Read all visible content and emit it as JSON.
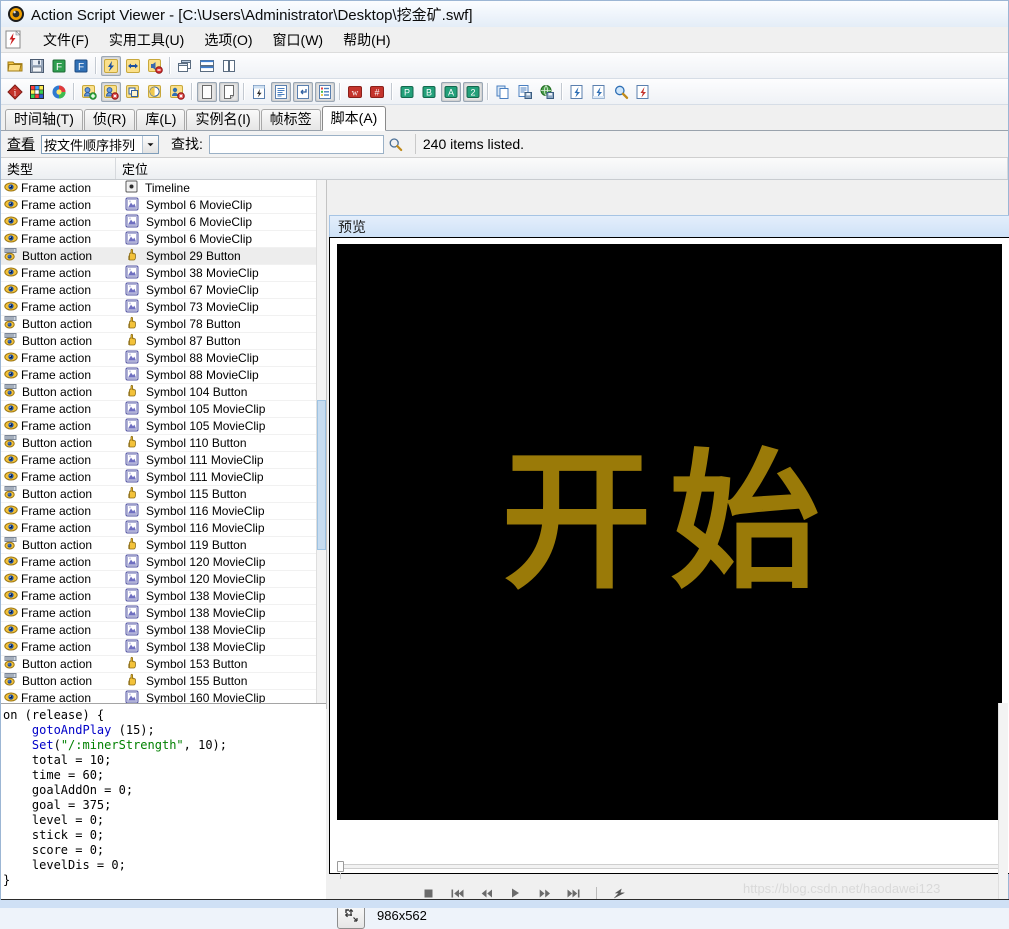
{
  "window": {
    "title": "Action Script Viewer - [C:\\Users\\Administrator\\Desktop\\挖金矿.swf]",
    "icon": "asv-app-icon"
  },
  "menubar": {
    "items": [
      {
        "label": "文件(F)",
        "name": "menu-file"
      },
      {
        "label": "实用工具(U)",
        "name": "menu-tools"
      },
      {
        "label": "选项(O)",
        "name": "menu-options"
      },
      {
        "label": "窗口(W)",
        "name": "menu-window"
      },
      {
        "label": "帮助(H)",
        "name": "menu-help"
      }
    ]
  },
  "toolbar_row1": [
    {
      "name": "open-icon",
      "kind": "sep",
      "sep": false
    },
    {
      "name": "open-folder-icon"
    },
    {
      "name": "save-icon"
    },
    {
      "name": "export-f-green-icon"
    },
    {
      "name": "export-f-blue-icon"
    },
    {
      "name": "flash-action-icon"
    },
    {
      "name": "resize-arrows-icon"
    },
    {
      "name": "remove-sound-icon"
    },
    {
      "name": "cascade-windows-icon"
    },
    {
      "name": "tile-horizontal-icon"
    },
    {
      "name": "tile-vertical-icon"
    }
  ],
  "toolbar_row2": [
    {
      "name": "info-diamond-icon"
    },
    {
      "name": "color-palette-icon"
    },
    {
      "name": "color-wheel-icon"
    },
    {
      "name": "add-symbol-icon"
    },
    {
      "name": "edit-symbol-icon"
    },
    {
      "name": "duplicate-symbol-icon"
    },
    {
      "name": "circle-gradient-icon"
    },
    {
      "name": "delete-symbol-icon"
    },
    {
      "name": "page-white-icon"
    },
    {
      "name": "page-note-icon"
    },
    {
      "name": "script-flash-icon"
    },
    {
      "name": "text-lines-icon"
    },
    {
      "name": "return-arrow-icon"
    },
    {
      "name": "list-detail-icon"
    },
    {
      "name": "w-red-icon"
    },
    {
      "name": "hash-red-icon"
    },
    {
      "name": "p-green-icon"
    },
    {
      "name": "b-green-icon"
    },
    {
      "name": "a-green-icon"
    },
    {
      "name": "two-green-icon"
    },
    {
      "name": "copy-icon"
    },
    {
      "name": "save-page-icon"
    },
    {
      "name": "save-web-icon"
    },
    {
      "name": "flash-export-icon"
    },
    {
      "name": "flash-export2-icon"
    },
    {
      "name": "zoom-search-icon"
    },
    {
      "name": "flash-red-icon"
    }
  ],
  "tabs": [
    {
      "label": "时间轴(T)",
      "name": "tab-timeline",
      "active": false
    },
    {
      "label": "侦(R)",
      "name": "tab-frames",
      "active": false
    },
    {
      "label": "库(L)",
      "name": "tab-library",
      "active": false
    },
    {
      "label": "实例名(I)",
      "name": "tab-instance-names",
      "active": false
    },
    {
      "label": "帧标签",
      "name": "tab-frame-labels",
      "active": false
    },
    {
      "label": "脚本(A)",
      "name": "tab-scripts",
      "active": true
    }
  ],
  "findbar": {
    "view_label": "查看",
    "sort_value": "按文件顺序排列",
    "find_label": "查找:",
    "find_value": "",
    "find_placeholder": "",
    "search_icon": "search-icon",
    "status": "240 items listed."
  },
  "list": {
    "columns": [
      "类型",
      "定位"
    ],
    "rows": [
      {
        "type": "Frame action",
        "icon": "frame-action-icon",
        "loc": "Timeline",
        "loc_icon": "timeline-icon",
        "selected": false
      },
      {
        "type": "Frame action",
        "icon": "frame-action-icon",
        "loc": "Symbol 6 MovieClip",
        "loc_icon": "movieclip-icon",
        "selected": false
      },
      {
        "type": "Frame action",
        "icon": "frame-action-icon",
        "loc": "Symbol 6 MovieClip",
        "loc_icon": "movieclip-icon",
        "selected": false
      },
      {
        "type": "Frame action",
        "icon": "frame-action-icon",
        "loc": "Symbol 6 MovieClip",
        "loc_icon": "movieclip-icon",
        "selected": false
      },
      {
        "type": "Button action",
        "icon": "button-action-icon",
        "loc": "Symbol 29 Button",
        "loc_icon": "button-icon",
        "selected": true
      },
      {
        "type": "Frame action",
        "icon": "frame-action-icon",
        "loc": "Symbol 38 MovieClip",
        "loc_icon": "movieclip-icon",
        "selected": false
      },
      {
        "type": "Frame action",
        "icon": "frame-action-icon",
        "loc": "Symbol 67 MovieClip",
        "loc_icon": "movieclip-icon",
        "selected": false
      },
      {
        "type": "Frame action",
        "icon": "frame-action-icon",
        "loc": "Symbol 73 MovieClip",
        "loc_icon": "movieclip-icon",
        "selected": false
      },
      {
        "type": "Button action",
        "icon": "button-action-icon",
        "loc": "Symbol 78 Button",
        "loc_icon": "button-icon",
        "selected": false
      },
      {
        "type": "Button action",
        "icon": "button-action-icon",
        "loc": "Symbol 87 Button",
        "loc_icon": "button-icon",
        "selected": false
      },
      {
        "type": "Frame action",
        "icon": "frame-action-icon",
        "loc": "Symbol 88 MovieClip",
        "loc_icon": "movieclip-icon",
        "selected": false
      },
      {
        "type": "Frame action",
        "icon": "frame-action-icon",
        "loc": "Symbol 88 MovieClip",
        "loc_icon": "movieclip-icon",
        "selected": false
      },
      {
        "type": "Button action",
        "icon": "button-action-icon",
        "loc": "Symbol 104 Button",
        "loc_icon": "button-icon",
        "selected": false
      },
      {
        "type": "Frame action",
        "icon": "frame-action-icon",
        "loc": "Symbol 105 MovieClip",
        "loc_icon": "movieclip-icon",
        "selected": false
      },
      {
        "type": "Frame action",
        "icon": "frame-action-icon",
        "loc": "Symbol 105 MovieClip",
        "loc_icon": "movieclip-icon",
        "selected": false
      },
      {
        "type": "Button action",
        "icon": "button-action-icon",
        "loc": "Symbol 110 Button",
        "loc_icon": "button-icon",
        "selected": false
      },
      {
        "type": "Frame action",
        "icon": "frame-action-icon",
        "loc": "Symbol 111 MovieClip",
        "loc_icon": "movieclip-icon",
        "selected": false
      },
      {
        "type": "Frame action",
        "icon": "frame-action-icon",
        "loc": "Symbol 111 MovieClip",
        "loc_icon": "movieclip-icon",
        "selected": false
      },
      {
        "type": "Button action",
        "icon": "button-action-icon",
        "loc": "Symbol 115 Button",
        "loc_icon": "button-icon",
        "selected": false
      },
      {
        "type": "Frame action",
        "icon": "frame-action-icon",
        "loc": "Symbol 116 MovieClip",
        "loc_icon": "movieclip-icon",
        "selected": false
      },
      {
        "type": "Frame action",
        "icon": "frame-action-icon",
        "loc": "Symbol 116 MovieClip",
        "loc_icon": "movieclip-icon",
        "selected": false
      },
      {
        "type": "Button action",
        "icon": "button-action-icon",
        "loc": "Symbol 119 Button",
        "loc_icon": "button-icon",
        "selected": false
      },
      {
        "type": "Frame action",
        "icon": "frame-action-icon",
        "loc": "Symbol 120 MovieClip",
        "loc_icon": "movieclip-icon",
        "selected": false
      },
      {
        "type": "Frame action",
        "icon": "frame-action-icon",
        "loc": "Symbol 120 MovieClip",
        "loc_icon": "movieclip-icon",
        "selected": false
      },
      {
        "type": "Frame action",
        "icon": "frame-action-icon",
        "loc": "Symbol 138 MovieClip",
        "loc_icon": "movieclip-icon",
        "selected": false
      },
      {
        "type": "Frame action",
        "icon": "frame-action-icon",
        "loc": "Symbol 138 MovieClip",
        "loc_icon": "movieclip-icon",
        "selected": false
      },
      {
        "type": "Frame action",
        "icon": "frame-action-icon",
        "loc": "Symbol 138 MovieClip",
        "loc_icon": "movieclip-icon",
        "selected": false
      },
      {
        "type": "Frame action",
        "icon": "frame-action-icon",
        "loc": "Symbol 138 MovieClip",
        "loc_icon": "movieclip-icon",
        "selected": false
      },
      {
        "type": "Button action",
        "icon": "button-action-icon",
        "loc": "Symbol 153 Button",
        "loc_icon": "button-icon",
        "selected": false
      },
      {
        "type": "Button action",
        "icon": "button-action-icon",
        "loc": "Symbol 155 Button",
        "loc_icon": "button-icon",
        "selected": false
      },
      {
        "type": "Frame action",
        "icon": "frame-action-icon",
        "loc": "Symbol 160 MovieClip",
        "loc_icon": "movieclip-icon",
        "selected": false
      }
    ]
  },
  "preview": {
    "header": "预览",
    "stage_text": "开始",
    "stage_text_color": "#9a7a08",
    "stage_bg": "#000000",
    "size_label": "986x562",
    "fit_icon": "fit-to-window-icon",
    "transport": [
      {
        "name": "stop-button",
        "glyph": "■"
      },
      {
        "name": "go-to-start-button",
        "glyph": "◀◀|"
      },
      {
        "name": "rewind-button",
        "glyph": "◀◀"
      },
      {
        "name": "play-button",
        "glyph": "▶"
      },
      {
        "name": "fast-forward-button",
        "glyph": "▶▶"
      },
      {
        "name": "go-to-end-button",
        "glyph": "|▶▶"
      },
      {
        "name": "flash-player-button",
        "glyph": "flash-icon"
      }
    ]
  },
  "code": {
    "lines": [
      [
        {
          "t": "on (release) {",
          "c": "plain"
        }
      ],
      [
        {
          "t": "    ",
          "c": "plain"
        },
        {
          "t": "gotoAndPlay",
          "c": "blue"
        },
        {
          "t": " (15);",
          "c": "plain"
        }
      ],
      [
        {
          "t": "    ",
          "c": "plain"
        },
        {
          "t": "Set",
          "c": "blue"
        },
        {
          "t": "(",
          "c": "plain"
        },
        {
          "t": "\"/:minerStrength\"",
          "c": "green"
        },
        {
          "t": ", 10);",
          "c": "plain"
        }
      ],
      [
        {
          "t": "    total = 10;",
          "c": "plain"
        }
      ],
      [
        {
          "t": "    time = 60;",
          "c": "plain"
        }
      ],
      [
        {
          "t": "    goalAddOn = 0;",
          "c": "plain"
        }
      ],
      [
        {
          "t": "    goal = 375;",
          "c": "plain"
        }
      ],
      [
        {
          "t": "    level = 0;",
          "c": "plain"
        }
      ],
      [
        {
          "t": "    stick = 0;",
          "c": "plain"
        }
      ],
      [
        {
          "t": "    score = 0;",
          "c": "plain"
        }
      ],
      [
        {
          "t": "    levelDis = 0;",
          "c": "plain"
        }
      ],
      [
        {
          "t": "}",
          "c": "plain"
        }
      ]
    ]
  },
  "watermark": "https://blog.csdn.net/haodawei123"
}
